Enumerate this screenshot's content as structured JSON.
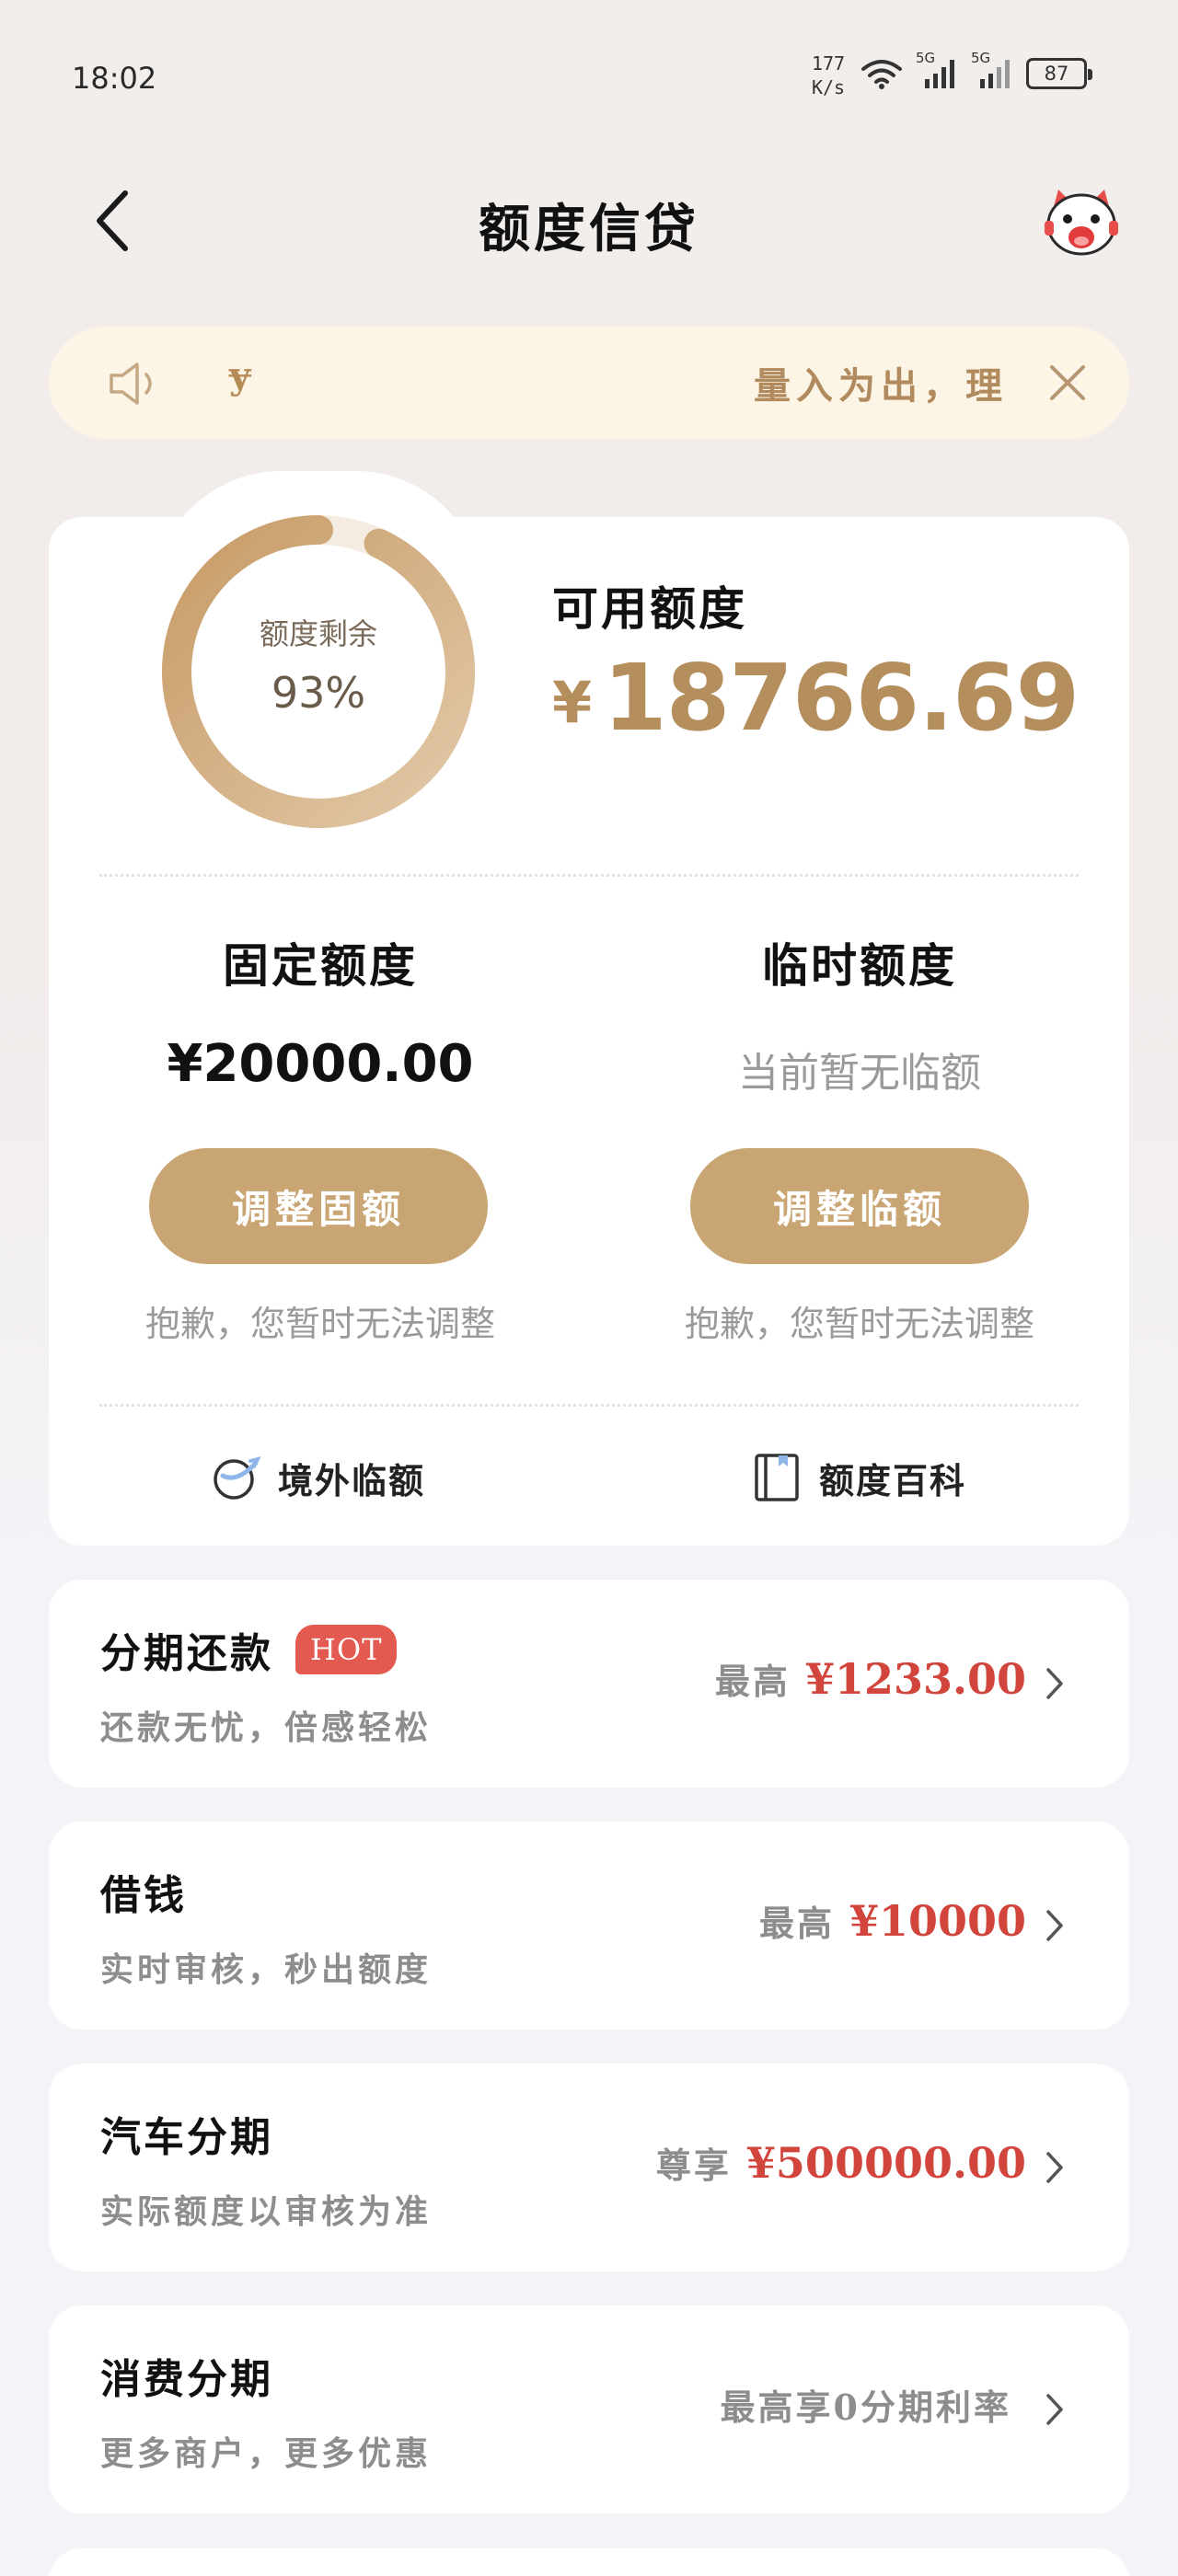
{
  "status_bar": {
    "time": "18:02",
    "net_speed_value": "177",
    "net_speed_unit": "K/s",
    "sim1": "5G",
    "sim2": "5G",
    "battery": "87"
  },
  "nav": {
    "title": "额度信贷",
    "back_icon": "chevron-left-icon",
    "mascot_icon": "cat-mascot-icon"
  },
  "notice": {
    "lead_glyph": "ɏ",
    "text": "量入为出，理",
    "speaker_icon": "speaker-icon",
    "close_icon": "close-icon"
  },
  "credit": {
    "remaining_label": "额度剩余",
    "remaining_percent_text": "93%",
    "remaining_fraction": 0.93,
    "available_label": "可用额度",
    "available_currency": "¥",
    "available_amount": "18766.69",
    "fixed": {
      "title": "固定额度",
      "amount": "¥20000.00",
      "button": "调整固额",
      "note": "抱歉，您暂时无法调整"
    },
    "temporary": {
      "title": "临时额度",
      "value": "当前暂无临额",
      "button": "调整临额",
      "note": "抱歉，您暂时无法调整"
    },
    "links": {
      "overseas": "境外临额",
      "wiki": "额度百科"
    }
  },
  "products": [
    {
      "title": "分期还款",
      "badge": "HOT",
      "subtitle": "还款无忧，倍感轻松",
      "prefix": "最高",
      "amount": "¥1233.00"
    },
    {
      "title": "借钱",
      "subtitle": "实时审核，秒出额度",
      "prefix": "最高",
      "amount": "¥10000"
    },
    {
      "title": "汽车分期",
      "subtitle": "实际额度以审核为准",
      "prefix": "尊享",
      "amount": "¥500000.00"
    },
    {
      "title": "消费分期",
      "subtitle": "更多商户，更多优惠",
      "prefix": "最高享0分期利率",
      "amount": ""
    }
  ],
  "colors": {
    "accent_gold": "#c9a574",
    "amount_gold": "#b58e5e",
    "highlight_red": "#d2453c",
    "hot_badge": "#e25a50",
    "notice_bg": "#fcf5e6"
  }
}
